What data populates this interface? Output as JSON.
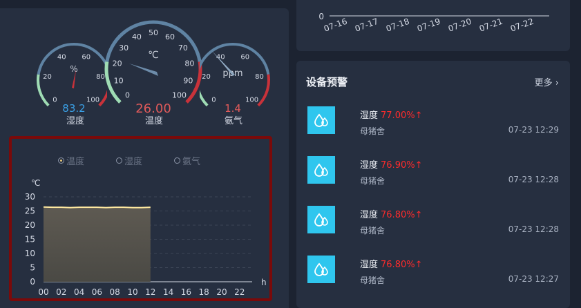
{
  "gauges": [
    {
      "name": "humidity",
      "unit": "%",
      "value": "83.2",
      "title": "湿度",
      "ticks": [
        "0",
        "20",
        "40",
        "60",
        "80",
        "100"
      ]
    },
    {
      "name": "temperature",
      "unit": "℃",
      "value": "26.00",
      "title": "温度",
      "ticks": [
        "0",
        "10",
        "20",
        "30",
        "40",
        "50",
        "60",
        "70",
        "80",
        "90",
        "100"
      ]
    },
    {
      "name": "ammonia",
      "unit": "ppm",
      "value": "1.4",
      "title": "氨气",
      "ticks": [
        "0",
        "20",
        "40",
        "60",
        "80",
        "100"
      ]
    }
  ],
  "colors": {
    "gauge_good": "#9fdcb4",
    "gauge_mid": "#5f83a3",
    "gauge_bad": "#c8323a",
    "needle": "#6d8caa",
    "accent_red": "#ff2b2b",
    "value_blue": "#3aa0e6",
    "line": "#ffe9a0"
  },
  "chart": {
    "radios": [
      "温度",
      "湿度",
      "氨气"
    ],
    "active_radio": 0
  },
  "chart_data": {
    "type": "area",
    "ylabel": "℃",
    "xunit": "h",
    "ylim": [
      0,
      30
    ],
    "yticks": [
      "0",
      "5",
      "10",
      "15",
      "20",
      "25",
      "30"
    ],
    "xticks": [
      "00",
      "02",
      "04",
      "06",
      "08",
      "10",
      "12",
      "14",
      "16",
      "18",
      "20",
      "22"
    ],
    "x": [
      0,
      1,
      2,
      3,
      4,
      5,
      6,
      7,
      8,
      9,
      10,
      11,
      12
    ],
    "values": [
      26.4,
      26.3,
      26.3,
      26.2,
      26.3,
      26.3,
      26.3,
      26.2,
      26.3,
      26.3,
      26.2,
      26.2,
      26.3
    ]
  },
  "top_chart": {
    "ytick": "0",
    "xticks": [
      "07-16",
      "07-17",
      "07-18",
      "07-19",
      "07-20",
      "07-21",
      "07-22"
    ]
  },
  "alerts": {
    "title": "设备预警",
    "more": "更多",
    "items": [
      {
        "label": "湿度",
        "value": "77.00%↑",
        "location": "母猪舍",
        "time": "07-23 12:29"
      },
      {
        "label": "湿度",
        "value": "76.90%↑",
        "location": "母猪舍",
        "time": "07-23 12:28"
      },
      {
        "label": "湿度",
        "value": "76.80%↑",
        "location": "母猪舍",
        "time": "07-23 12:28"
      },
      {
        "label": "湿度",
        "value": "76.80%↑",
        "location": "母猪舍",
        "time": "07-23 12:27"
      }
    ]
  }
}
